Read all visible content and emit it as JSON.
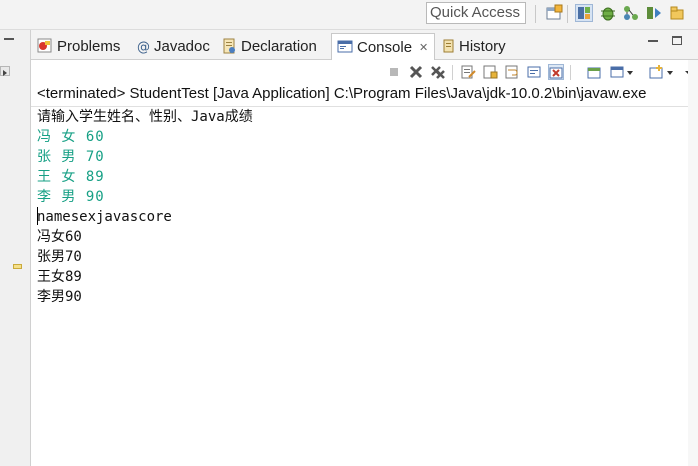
{
  "topbar": {
    "quick_access_placeholder": "Quick Access",
    "perspectives": [
      "perspective-open-icon",
      "java-perspective-icon",
      "debug-perspective-icon",
      "git-perspective-icon",
      "team-sync-icon",
      "resource-perspective-icon"
    ]
  },
  "tabs": [
    {
      "label": "Problems",
      "icon": "problems-icon",
      "active": false
    },
    {
      "label": "Javadoc",
      "icon": "at-sign-icon",
      "active": false
    },
    {
      "label": "Declaration",
      "icon": "declaration-icon",
      "active": false
    },
    {
      "label": "Console",
      "icon": "console-icon",
      "active": true,
      "close": "✕"
    },
    {
      "label": "History",
      "icon": "history-icon",
      "active": false
    }
  ],
  "console": {
    "status": "<terminated> StudentTest [Java Application] C:\\Program Files\\Java\\jdk-10.0.2\\bin\\javaw.exe",
    "lines": [
      {
        "text": "请输入学生姓名、性别、Java成绩",
        "kind": "output"
      },
      {
        "text": "冯 女 60",
        "kind": "input"
      },
      {
        "text": "张 男 70",
        "kind": "input"
      },
      {
        "text": "王 女 89",
        "kind": "input"
      },
      {
        "text": "李 男 90",
        "kind": "input"
      },
      {
        "text": "namesexjavascore",
        "kind": "output"
      },
      {
        "text": "冯女60",
        "kind": "output"
      },
      {
        "text": "张男70",
        "kind": "output"
      },
      {
        "text": "王女89",
        "kind": "output"
      },
      {
        "text": "李男90",
        "kind": "output"
      }
    ]
  },
  "colors": {
    "input_text": "#16a085",
    "output_text": "#111111",
    "terminate_red": "#c0392b",
    "active_tab_bg": "#ffffff"
  }
}
